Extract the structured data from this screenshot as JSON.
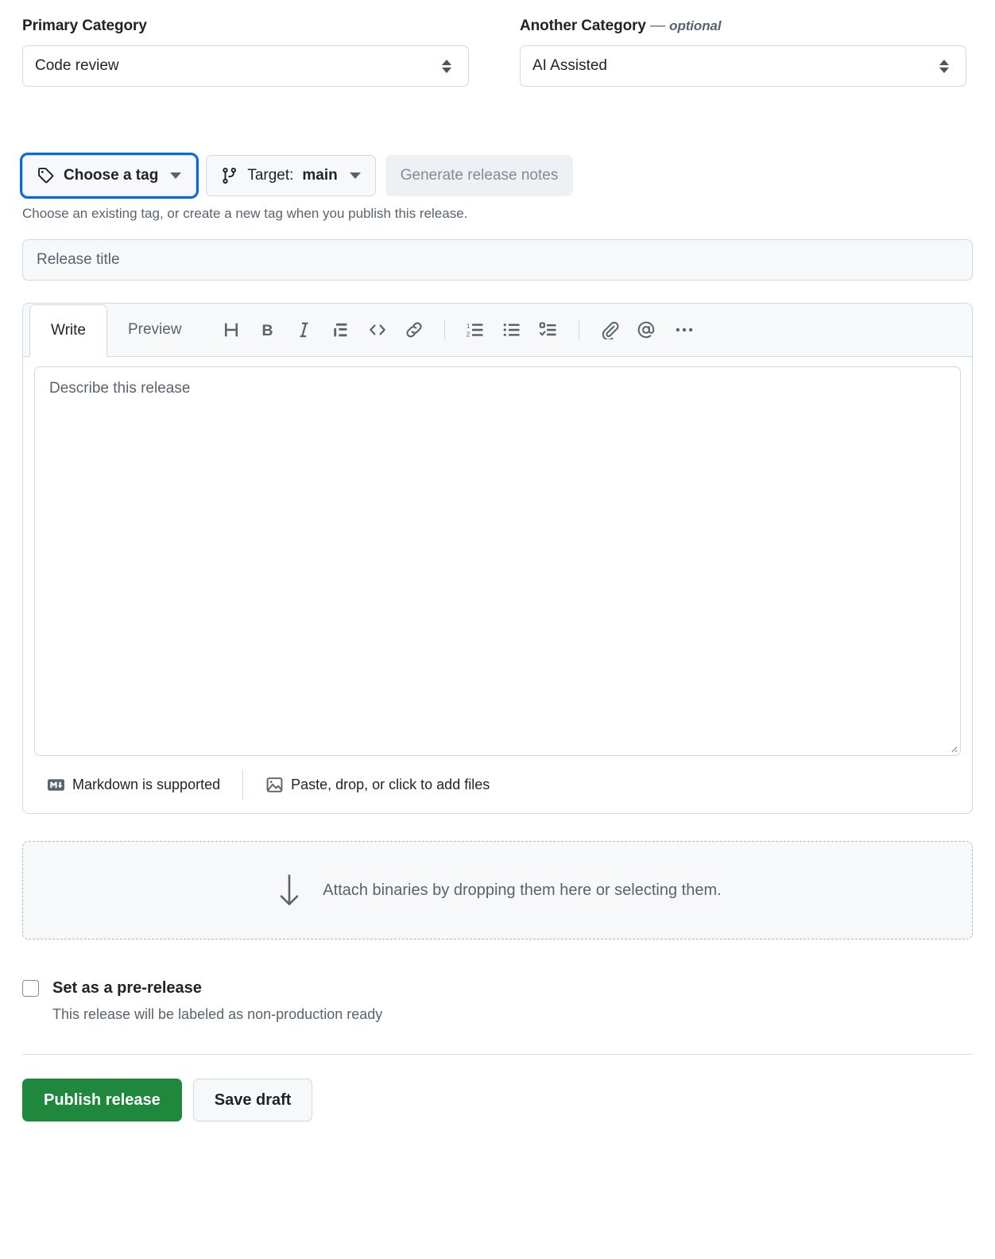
{
  "categories": {
    "primary": {
      "label": "Primary Category",
      "value": "Code review",
      "icon": "select-arrows-icon"
    },
    "another": {
      "label": "Another Category",
      "dash": "—",
      "optional": "optional",
      "value": "AI Assisted",
      "icon": "select-arrows-icon"
    }
  },
  "tag_row": {
    "choose_tag": {
      "label": "Choose a tag",
      "icon": "tag-icon",
      "caret": "chevron-down-icon",
      "focused": true
    },
    "target": {
      "prefix": "Target:",
      "value": "main",
      "icon": "git-branch-icon",
      "caret": "chevron-down-icon"
    },
    "generate_notes": {
      "label": "Generate release notes",
      "disabled": true
    },
    "help_text": "Choose an existing tag, or create a new tag when you publish this release."
  },
  "release_title": {
    "placeholder": "Release title",
    "value": ""
  },
  "editor": {
    "tabs": [
      {
        "label": "Write",
        "active": true
      },
      {
        "label": "Preview",
        "active": false
      }
    ],
    "tools": [
      {
        "name": "heading-icon",
        "title": "Heading"
      },
      {
        "name": "bold-icon",
        "title": "Bold"
      },
      {
        "name": "italic-icon",
        "title": "Italic"
      },
      {
        "name": "quote-icon",
        "title": "Quote"
      },
      {
        "name": "code-icon",
        "title": "Code"
      },
      {
        "name": "link-icon",
        "title": "Link"
      },
      {
        "name": "ordered-list-icon",
        "title": "Numbered list"
      },
      {
        "name": "unordered-list-icon",
        "title": "Bulleted list"
      },
      {
        "name": "task-list-icon",
        "title": "Task list"
      },
      {
        "name": "attachment-icon",
        "title": "Attach files"
      },
      {
        "name": "mention-icon",
        "title": "Mention"
      },
      {
        "name": "kebab-horizontal-icon",
        "title": "More"
      }
    ],
    "body": {
      "placeholder": "Describe this release",
      "value": ""
    },
    "footer": {
      "markdown": {
        "label": "Markdown is supported",
        "icon": "markdown-icon"
      },
      "files": {
        "label": "Paste, drop, or click to add files",
        "icon": "image-icon"
      }
    }
  },
  "dropzone": {
    "label": "Attach binaries by dropping them here or selecting them.",
    "icon": "arrow-down-icon"
  },
  "prerelease": {
    "label": "Set as a pre-release",
    "description": "This release will be labeled as non-production ready",
    "checked": false
  },
  "actions": {
    "publish": "Publish release",
    "save_draft": "Save draft"
  },
  "colors": {
    "accent": "#0969da",
    "success": "#1f883d",
    "border": "#d1d9e0",
    "muted_text": "#59636e",
    "canvas_subtle": "#f6f8fa"
  }
}
